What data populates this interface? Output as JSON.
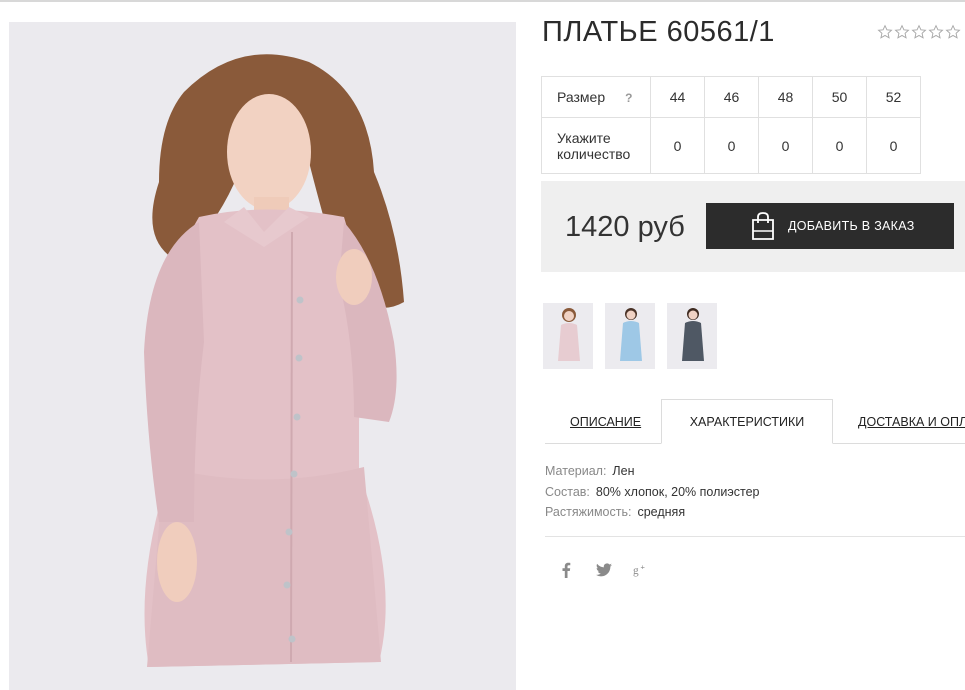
{
  "product": {
    "title": "ПЛАТЬЕ 60561/1",
    "rating": 0
  },
  "size_table": {
    "size_label": "Размер",
    "help": "?",
    "qty_label": "Укажите количество",
    "sizes": [
      "44",
      "46",
      "48",
      "50",
      "52"
    ],
    "quantities": [
      "0",
      "0",
      "0",
      "0",
      "0"
    ]
  },
  "purchase": {
    "price": "1420 руб",
    "add_button": "ДОБАВИТЬ В ЗАКАЗ"
  },
  "tabs": {
    "description": "ОПИСАНИЕ",
    "characteristics": "ХАРАКТЕРИСТИКИ",
    "delivery": "ДОСТАВКА И ОПЛА"
  },
  "specs": [
    {
      "key": "Материал:",
      "value": "Лен"
    },
    {
      "key": "Состав:",
      "value": "80% хлопок, 20% полиэстер"
    },
    {
      "key": "Растяжимость:",
      "value": "средняя"
    }
  ],
  "thumbnails": [
    {
      "color": "#e8cfd4"
    },
    {
      "color": "#a8cde8"
    },
    {
      "color": "#4d5661"
    }
  ],
  "social": [
    "facebook-icon",
    "twitter-icon",
    "google-plus-icon"
  ]
}
